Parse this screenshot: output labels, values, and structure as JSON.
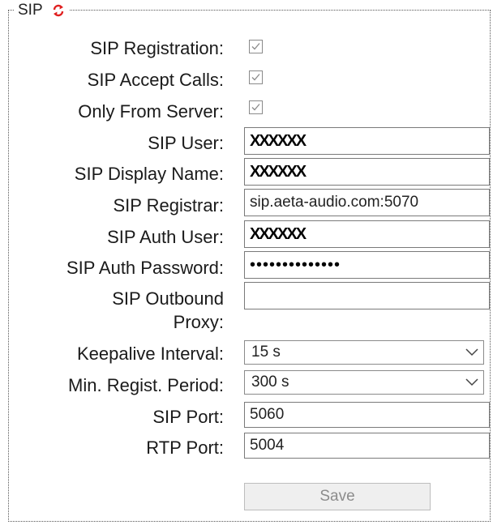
{
  "section": {
    "title": "SIP",
    "refresh_icon": "refresh-arrows-icon",
    "refresh_color": "#e02020"
  },
  "fields": {
    "sip_registration": {
      "label": "SIP Registration:",
      "checked": true
    },
    "sip_accept_calls": {
      "label": "SIP Accept Calls:",
      "checked": true
    },
    "only_from_server": {
      "label": "Only From Server:",
      "checked": true
    },
    "sip_user": {
      "label": "SIP User:",
      "value": "XXXXXX"
    },
    "sip_display_name": {
      "label": "SIP Display Name:",
      "value": "XXXXXX"
    },
    "sip_registrar": {
      "label": "SIP Registrar:",
      "value": "sip.aeta-audio.com:5070"
    },
    "sip_auth_user": {
      "label": "SIP Auth User:",
      "value": "XXXXXX"
    },
    "sip_auth_password": {
      "label": "SIP Auth Password:",
      "value": "••••••••••••••"
    },
    "sip_outbound_proxy": {
      "label": "SIP Outbound Proxy:",
      "value": ""
    },
    "keepalive_interval": {
      "label": "Keepalive Interval:",
      "value": "15 s"
    },
    "min_regist_period": {
      "label": "Min. Regist. Period:",
      "value": "300 s"
    },
    "sip_port": {
      "label": "SIP Port:",
      "value": "5060"
    },
    "rtp_port": {
      "label": "RTP Port:",
      "value": "5004"
    }
  },
  "actions": {
    "save_label": "Save"
  }
}
